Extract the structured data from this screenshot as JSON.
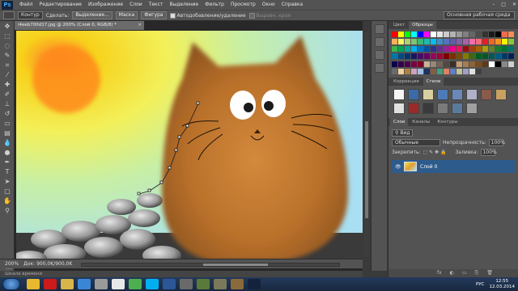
{
  "app": {
    "logo": "Ps",
    "window_controls": [
      "–",
      "□",
      "✕"
    ]
  },
  "menu": [
    "Файл",
    "Редактирование",
    "Изображение",
    "Слои",
    "Текст",
    "Выделение",
    "Фильтр",
    "Просмотр",
    "Окно",
    "Справка"
  ],
  "options": {
    "mode": "Контур",
    "create_label": "Сделать:",
    "btn_selection": "Выделение...",
    "btn_mask": "Маска",
    "btn_shape": "Фигура",
    "auto_add": "Автодобавление/удаление",
    "align_edges": "Выровн. края",
    "workspace": "Основная рабочая среда"
  },
  "document": {
    "tab": "i4eeb700d17.jpg @ 200% (Слой 0, RGB/8) *",
    "close": "×",
    "zoom": "200%",
    "doc_size": "Док: 900,0K/900,0K"
  },
  "timeline": "Шкала времени",
  "panels": {
    "color_tabs": [
      "Цвет",
      "Образцы"
    ],
    "adj_tabs": [
      "Коррекция",
      "Стили"
    ],
    "layers_tabs": [
      "Слои",
      "Каналы",
      "Контуры"
    ],
    "kind_label": "Вид",
    "blend_mode": "Обычные",
    "opacity_label": "Непрозрачность:",
    "opacity_value": "100%",
    "lock_label": "Закрепить:",
    "fill_label": "Заливка:",
    "fill_value": "100%",
    "layer_name": "Слой 0",
    "footer_icons": [
      "fx",
      "◐",
      "▭",
      "⎘",
      "🗑"
    ]
  },
  "swatch_colors": [
    "#ff0000",
    "#ffff00",
    "#00ff00",
    "#00ffff",
    "#0000ff",
    "#ff00ff",
    "#ffffff",
    "#e6e6e6",
    "#cccccc",
    "#b3b3b3",
    "#999999",
    "#808080",
    "#666666",
    "#4d4d4d",
    "#333333",
    "#1a1a1a",
    "#000000",
    "#f26c4f",
    "#f68e56",
    "#fbaf5d",
    "#fff467",
    "#acd372",
    "#7cc576",
    "#3bb878",
    "#1abbb4",
    "#00bff3",
    "#438ccb",
    "#5574b9",
    "#605ca8",
    "#855fa8",
    "#a763a8",
    "#f06ea9",
    "#f26d7d",
    "#ed1c24",
    "#f26522",
    "#f7941d",
    "#fff200",
    "#8dc63f",
    "#39b54a",
    "#00a651",
    "#00a99d",
    "#00aeef",
    "#0072bc",
    "#0054a6",
    "#2e3192",
    "#662d91",
    "#92278f",
    "#ec008c",
    "#ed145b",
    "#9e0b0f",
    "#a0410d",
    "#a3620a",
    "#aba000",
    "#598527",
    "#197b30",
    "#007236",
    "#00746b",
    "#0076a3",
    "#004b80",
    "#003471",
    "#1b1464",
    "#440e62",
    "#630460",
    "#9e005d",
    "#9e0039",
    "#790000",
    "#7b2e00",
    "#7d4900",
    "#827b00",
    "#406618",
    "#005e20",
    "#005826",
    "#005952",
    "#005b7f",
    "#003663",
    "#002157",
    "#0d004c",
    "#32004b",
    "#4b0049",
    "#7b0046",
    "#7a0026",
    "#c7b299",
    "#998675",
    "#736357",
    "#534741",
    "#37302d",
    "#c69c6d",
    "#a67c52",
    "#8c6239",
    "#754c24",
    "#603913",
    "#ffffff",
    "#000000",
    "#898989",
    "#cfcfcf",
    "#6b6b6b",
    "#f0d0a0",
    "#b08040",
    "#d0a0c0",
    "#a0c0e0",
    "#203060",
    "#806040",
    "#40a080",
    "#e08060",
    "#6080c0",
    "#c0c0a0",
    "#a0a0c0",
    "#e0e0e0",
    "#404040"
  ],
  "taskbar": {
    "icons": [
      {
        "name": "chrome",
        "color": "#e8b82e"
      },
      {
        "name": "opera",
        "color": "#cc1b1b"
      },
      {
        "name": "explorer",
        "color": "#d9b44a"
      },
      {
        "name": "player",
        "color": "#3a86d6"
      },
      {
        "name": "app",
        "color": "#9a9a9a"
      },
      {
        "name": "yandex",
        "color": "#e8e8e8"
      },
      {
        "name": "chrome2",
        "color": "#4caf50"
      },
      {
        "name": "skype",
        "color": "#00aff0"
      },
      {
        "name": "word",
        "color": "#2b5797"
      },
      {
        "name": "media",
        "color": "#6a6a6a"
      },
      {
        "name": "game",
        "color": "#5a7a3a"
      },
      {
        "name": "app2",
        "color": "#7a7a5a"
      },
      {
        "name": "app3",
        "color": "#8a6a3a"
      },
      {
        "name": "photoshop",
        "color": "#14233b"
      }
    ],
    "lang": "РУС",
    "time": "12:55",
    "date": "12.03.2014"
  }
}
